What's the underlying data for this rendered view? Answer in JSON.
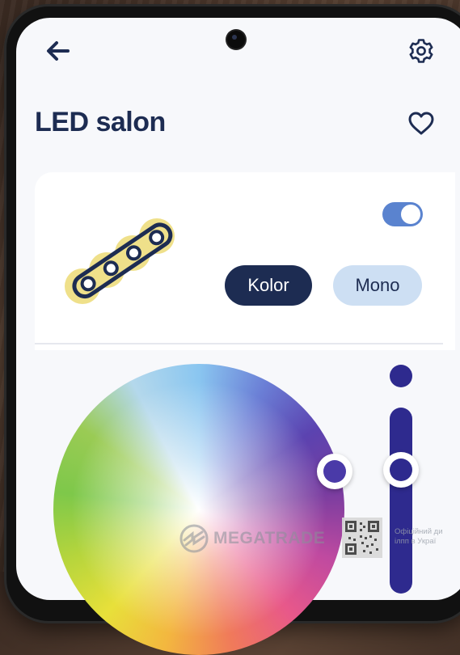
{
  "header": {
    "title": "LED salon",
    "back_icon": "arrow-left-icon",
    "settings_icon": "gear-icon",
    "favorite_icon": "heart-icon"
  },
  "device_card": {
    "icon": "led-strip-icon",
    "power_toggle": {
      "state": "on"
    },
    "modes": [
      {
        "label": "Kolor",
        "selected": true
      },
      {
        "label": "Mono",
        "selected": false
      }
    ]
  },
  "color_controls": {
    "wheel": "color-wheel",
    "brightness_slider": "brightness-slider"
  },
  "watermark": {
    "brand": "MEGATRADE",
    "caption_line1": "Офіційний ди",
    "caption_line2": "ілпп в Украї"
  },
  "colors": {
    "primary_dark": "#1d2c52",
    "accent_blue": "#5a83cf",
    "mono_pill": "#cddff3",
    "slider": "#2e2a8e",
    "led_glow": "#efe08a"
  }
}
